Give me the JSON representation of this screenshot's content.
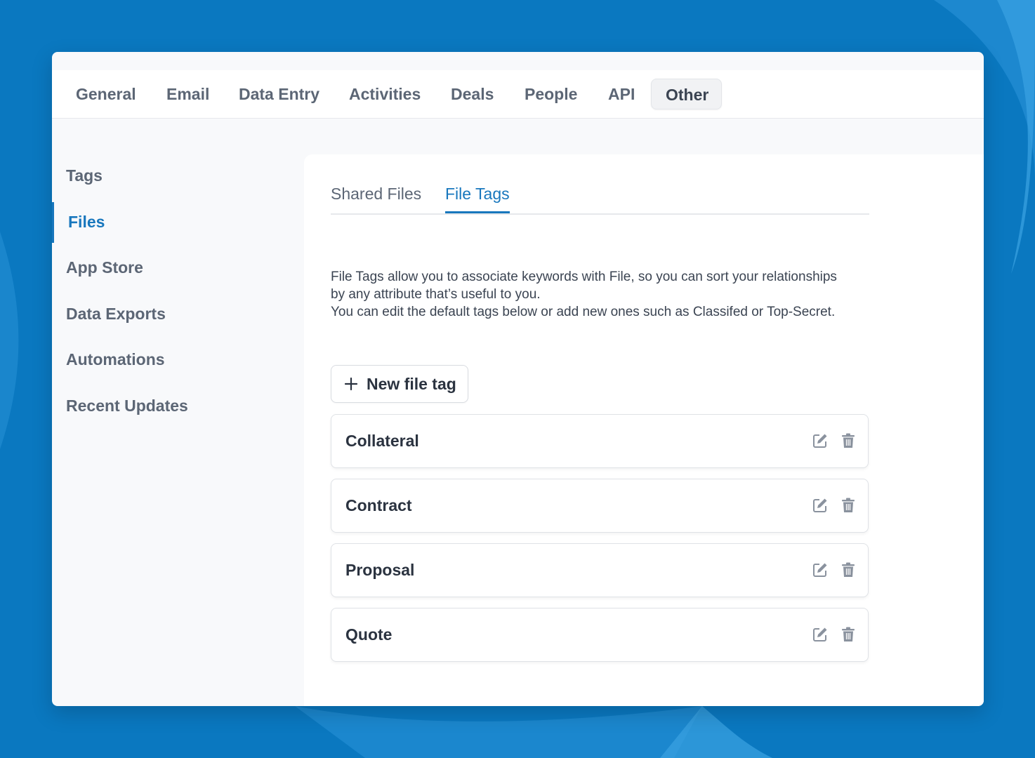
{
  "colors": {
    "background": "#0a78c0",
    "accent": "#1877bd",
    "text_muted": "#5c6675",
    "text_dark": "#2b3340"
  },
  "topnav": {
    "tabs": [
      {
        "label": "General"
      },
      {
        "label": "Email"
      },
      {
        "label": "Data Entry"
      },
      {
        "label": "Activities"
      },
      {
        "label": "Deals"
      },
      {
        "label": "People"
      },
      {
        "label": "API"
      },
      {
        "label": "Other",
        "active": true
      }
    ]
  },
  "sidebar": {
    "items": [
      {
        "label": "Tags"
      },
      {
        "label": "Files",
        "active": true
      },
      {
        "label": "App Store"
      },
      {
        "label": "Data Exports"
      },
      {
        "label": "Automations"
      },
      {
        "label": "Recent Updates"
      }
    ]
  },
  "subtabs": [
    {
      "label": "Shared Files"
    },
    {
      "label": "File Tags",
      "active": true
    }
  ],
  "description": {
    "line1": "File Tags allow you to associate keywords with File, so you can sort your relationships by any attribute that’s useful to you.",
    "line2": "You can edit the default tags below or add new ones such as Classifed or Top-Secret."
  },
  "new_button": {
    "label": "New file tag",
    "icon": "plus-icon"
  },
  "tags": [
    {
      "name": "Collateral"
    },
    {
      "name": "Contract"
    },
    {
      "name": "Proposal"
    },
    {
      "name": "Quote"
    }
  ],
  "row_actions": {
    "edit_icon": "edit-icon",
    "delete_icon": "trash-icon"
  }
}
